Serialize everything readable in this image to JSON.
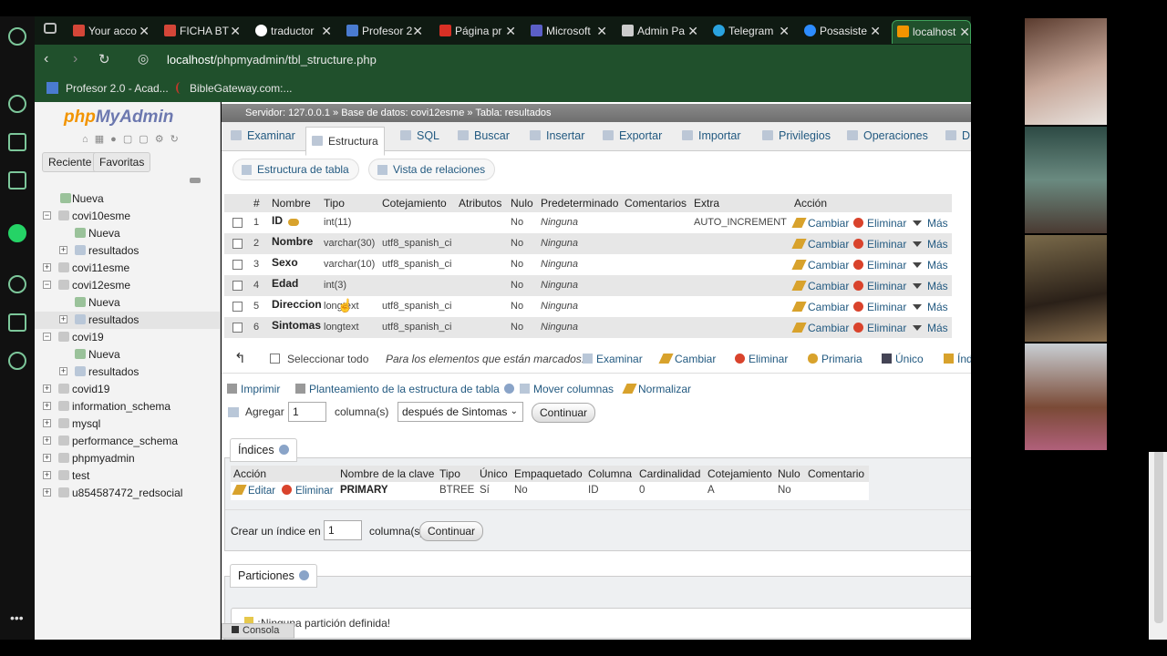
{
  "browser": {
    "tabs": [
      {
        "label": "Your acco",
        "color": "#d44638"
      },
      {
        "label": "FICHA BT",
        "color": "#d44638"
      },
      {
        "label": "traductor",
        "color": "#ffffff"
      },
      {
        "label": "Profesor 2",
        "color": "#4a7bd0"
      },
      {
        "label": "Página pr",
        "color": "#d93025"
      },
      {
        "label": "Microsoft",
        "color": "#5b5fc7"
      },
      {
        "label": "Admin Pa",
        "color": "#cccccc"
      },
      {
        "label": "Telegram",
        "color": "#2aa3df"
      },
      {
        "label": "Posasiste",
        "color": "#2d8cff"
      },
      {
        "label": "localhost",
        "color": "#f29400"
      }
    ],
    "url_host": "localhost",
    "url_path": "/phpmyadmin/tbl_structure.php",
    "bookmarks": [
      {
        "label": "Profesor 2.0 - Acad..."
      },
      {
        "label": "BibleGateway.com:..."
      }
    ]
  },
  "sidebar": {
    "logo_php": "php",
    "logo_myadmin": "MyAdmin",
    "recent_label": "Reciente",
    "favorites_label": "Favoritas",
    "tree": [
      {
        "label": "Nueva"
      },
      {
        "label": "covi10esme"
      },
      {
        "label": "Nueva"
      },
      {
        "label": "resultados"
      },
      {
        "label": "covi11esme"
      },
      {
        "label": "covi12esme"
      },
      {
        "label": "Nueva"
      },
      {
        "label": "resultados"
      },
      {
        "label": "covi19"
      },
      {
        "label": "Nueva"
      },
      {
        "label": "resultados"
      },
      {
        "label": "covid19"
      },
      {
        "label": "information_schema"
      },
      {
        "label": "mysql"
      },
      {
        "label": "performance_schema"
      },
      {
        "label": "phpmyadmin"
      },
      {
        "label": "test"
      },
      {
        "label": "u854587472_redsocial"
      }
    ]
  },
  "breadcrumb": {
    "server": "Servidor: 127.0.0.1",
    "sep1": "»",
    "database": "Base de datos: covi12esme",
    "sep2": "»",
    "table": "Tabla: resultados"
  },
  "top_tabs": [
    "Examinar",
    "Estructura",
    "SQL",
    "Buscar",
    "Insertar",
    "Exportar",
    "Importar",
    "Privilegios",
    "Operaciones",
    "D"
  ],
  "sub_tabs": [
    "Estructura de tabla",
    "Vista de relaciones"
  ],
  "columns_table": {
    "headers": [
      "#",
      "Nombre",
      "Tipo",
      "Cotejamiento",
      "Atributos",
      "Nulo",
      "Predeterminado",
      "Comentarios",
      "Extra",
      "Acción"
    ],
    "rows": [
      {
        "num": "1",
        "name": "ID",
        "type": "int(11)",
        "collation": "",
        "null": "No",
        "default": "Ninguna",
        "extra": "AUTO_INCREMENT"
      },
      {
        "num": "2",
        "name": "Nombre",
        "type": "varchar(30)",
        "collation": "utf8_spanish_ci",
        "null": "No",
        "default": "Ninguna",
        "extra": ""
      },
      {
        "num": "3",
        "name": "Sexo",
        "type": "varchar(10)",
        "collation": "utf8_spanish_ci",
        "null": "No",
        "default": "Ninguna",
        "extra": ""
      },
      {
        "num": "4",
        "name": "Edad",
        "type": "int(3)",
        "collation": "",
        "null": "No",
        "default": "Ninguna",
        "extra": ""
      },
      {
        "num": "5",
        "name": "Direccion",
        "type": "longtext",
        "collation": "utf8_spanish_ci",
        "null": "No",
        "default": "Ninguna",
        "extra": ""
      },
      {
        "num": "6",
        "name": "Sintomas",
        "type": "longtext",
        "collation": "utf8_spanish_ci",
        "null": "No",
        "default": "Ninguna",
        "extra": ""
      }
    ],
    "action_change": "Cambiar",
    "action_delete": "Eliminar",
    "action_more": "Más"
  },
  "bulk": {
    "select_all": "Seleccionar todo",
    "marked_label": "Para los elementos que están marcados:",
    "actions": [
      "Examinar",
      "Cambiar",
      "Eliminar",
      "Primaria",
      "Único",
      "Índ"
    ]
  },
  "links": {
    "print": "Imprimir",
    "plan": "Planteamiento de la estructura de tabla",
    "move": "Mover columnas",
    "normalize": "Normalizar"
  },
  "add_columns": {
    "label": "Agregar",
    "value": "1",
    "unit": "columna(s)",
    "position": "después de Sintomas",
    "button": "Continuar"
  },
  "indexes": {
    "legend": "Índices",
    "headers": [
      "Acción",
      "Nombre de la clave",
      "Tipo",
      "Único",
      "Empaquetado",
      "Columna",
      "Cardinalidad",
      "Cotejamiento",
      "Nulo",
      "Comentario"
    ],
    "row": {
      "edit": "Editar",
      "delete": "Eliminar",
      "key": "PRIMARY",
      "type": "BTREE",
      "unique": "Sí",
      "packed": "No",
      "column": "ID",
      "cardinality": "0",
      "collation": "A",
      "null": "No"
    },
    "create_label": "Crear un índice en",
    "create_value": "1",
    "create_unit": "columna(s)",
    "create_button": "Continuar"
  },
  "partitions": {
    "legend": "Particiones",
    "message": "¡Ninguna partición definida!"
  },
  "console": "Consola"
}
